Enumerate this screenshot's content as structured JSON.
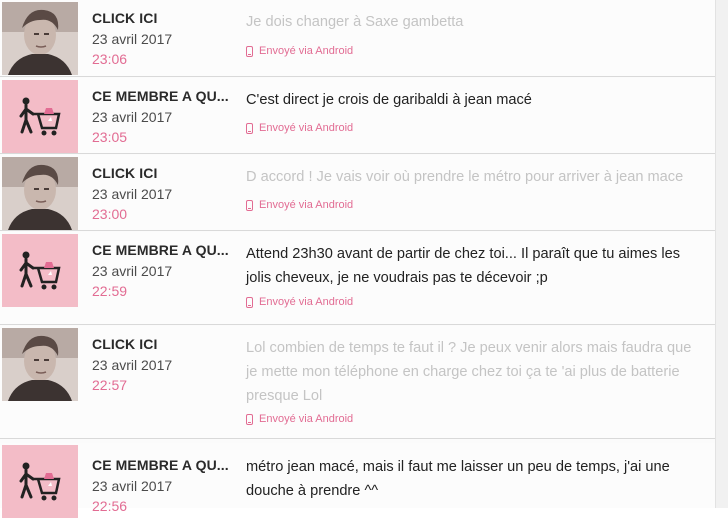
{
  "colors": {
    "accent": "#e26c93",
    "avatar_bg": "#f3bcc7"
  },
  "thread": {
    "messages": [
      {
        "author": "CLICK ICI",
        "author_type": "user",
        "date": "23 avril 2017",
        "time": "23:06",
        "text": "Je dois changer à Saxe gambetta",
        "via": "Envoyé via Android",
        "icon": "phone-icon"
      },
      {
        "author": "CE MEMBRE A QU...",
        "author_type": "member",
        "date": "23 avril 2017",
        "time": "23:05",
        "text": "C'est direct je crois de garibaldi à jean macé",
        "via": "Envoyé via Android",
        "icon": "phone-icon"
      },
      {
        "author": "CLICK ICI",
        "author_type": "user",
        "date": "23 avril 2017",
        "time": "23:00",
        "text": "D accord ! Je vais voir où prendre le métro pour arriver à jean mace",
        "via": "Envoyé via Android",
        "icon": "phone-icon"
      },
      {
        "author": "CE MEMBRE A QU...",
        "author_type": "member",
        "date": "23 avril 2017",
        "time": "22:59",
        "text": "Attend 23h30 avant de partir de chez toi... Il paraît que tu aimes les jolis cheveux, je ne voudrais pas te décevoir ;p",
        "via": "Envoyé via Android",
        "icon": "phone-icon"
      },
      {
        "author": "CLICK ICI",
        "author_type": "user",
        "date": "23 avril 2017",
        "time": "22:57",
        "text": "Lol combien de temps te faut il ? Je peux venir alors mais faudra que je mette mon téléphone en charge chez toi ça te 'ai plus de batterie presque Lol",
        "via": "Envoyé via Android",
        "icon": "phone-icon"
      },
      {
        "author": "CE MEMBRE A QU...",
        "author_type": "member",
        "date": "23 avril 2017",
        "time": "22:56",
        "text": "métro jean macé, mais il faut me laisser un peu de temps, j'ai une douche à prendre ^^",
        "via": "",
        "icon": "phone-icon"
      }
    ]
  }
}
